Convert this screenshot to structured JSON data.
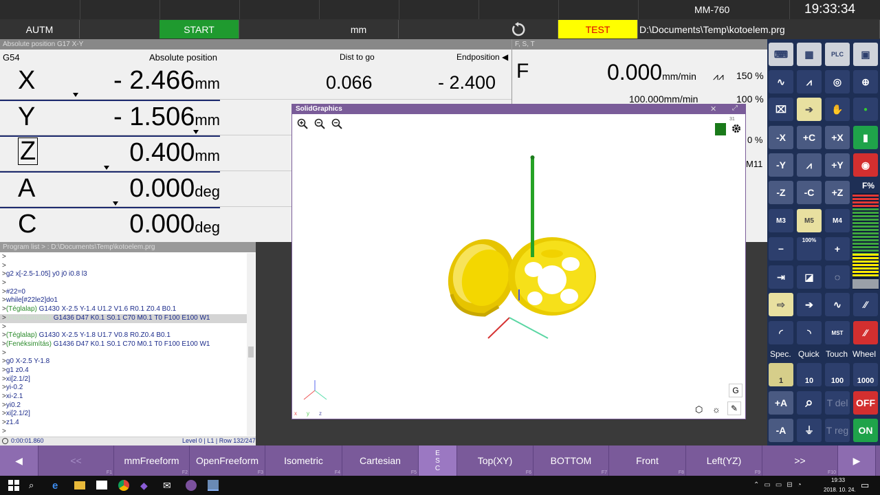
{
  "topbar": {
    "machine": "MM-760",
    "clock": "19:33:34"
  },
  "modebar": {
    "mode": "AUTM",
    "start": "START",
    "unit": "mm",
    "test": "TEST",
    "file": "D:\\Documents\\Temp\\kotoelem.prg"
  },
  "position_panel": {
    "title": "Absolute position G17 X-Y",
    "wcs": "G54",
    "col_abs": "Absolute position",
    "col_dist": "Dist to go",
    "col_end": "Endposition ◀",
    "axes": [
      {
        "name": "X",
        "value": "- 2.466",
        "unit": "mm",
        "dist": "0.066",
        "end": "- 2.400"
      },
      {
        "name": "Y",
        "value": "- 1.506",
        "unit": "mm"
      },
      {
        "name": "Z",
        "value": "0.400",
        "unit": "mm"
      },
      {
        "name": "A",
        "value": "0.000",
        "unit": "deg"
      },
      {
        "name": "C",
        "value": "0.000",
        "unit": "deg"
      }
    ]
  },
  "feed_panel": {
    "title": "F, S, T",
    "f_label": "F",
    "f_value": "0.000",
    "f_unit": "mm/min",
    "f_override": "150 %",
    "f_prog": "100.000mm/min",
    "f_prog_override": "100 %",
    "partial_pct": "0 %",
    "partial_m": "M11"
  },
  "program": {
    "title": "Program list > : D:\\Documents\\Temp\\kotoelem.prg",
    "lines": [
      {
        "p": ">",
        "c": "",
        "t": ""
      },
      {
        "p": ">",
        "c": "",
        "t": ""
      },
      {
        "p": ">",
        "c": "",
        "t": "g2 x[-2.5-1.05] y0 j0 i0.8 l3"
      },
      {
        "p": ">",
        "c": "",
        "t": ""
      },
      {
        "p": ">",
        "c": "",
        "t": "#22=0"
      },
      {
        "p": ">",
        "c": "",
        "t": "while[#22le2]do1"
      },
      {
        "p": ">",
        "c": "(Téglalap)",
        "t": " G1430 X-2.5 Y-1.4 U1.2 V1.6 R0.1 Z0.4 B0.1"
      },
      {
        "p": ">",
        "c": "(Fenéksimítás)",
        "t": " G1436 D47 K0.1 S0.1 C70 M0.1 T0 F100 E100 W1",
        "hl": true
      },
      {
        "p": ">",
        "c": "",
        "t": ""
      },
      {
        "p": ">",
        "c": "(Téglalap)",
        "t": " G1430 X-2.5 Y-1.8 U1.7 V0.8 R0.Z0.4 B0.1"
      },
      {
        "p": ">",
        "c": "(Fenéksimítás)",
        "t": " G1436 D47 K0.1 S0.1 C70 M0.1 T0 F100 E100 W1"
      },
      {
        "p": ">",
        "c": "",
        "t": ""
      },
      {
        "p": ">",
        "c": "",
        "t": "g0 X-2.5 Y-1.8"
      },
      {
        "p": ">",
        "c": "",
        "t": "g1 z0.4"
      },
      {
        "p": ">",
        "c": "",
        "t": "xi[2.1/2]"
      },
      {
        "p": ">",
        "c": "",
        "t": "yi-0.2"
      },
      {
        "p": ">",
        "c": "",
        "t": "xi-2.1"
      },
      {
        "p": ">",
        "c": "",
        "t": "yi0.2"
      },
      {
        "p": ">",
        "c": "",
        "t": "xi[2.1/2]"
      },
      {
        "p": ">",
        "c": "",
        "t": "z1.4"
      },
      {
        "p": ">",
        "c": "",
        "t": ""
      }
    ],
    "time": "0:00:01.860",
    "status": "Level 0 | L1 | Row 132/247"
  },
  "solidgraphics": {
    "title": "SolidGraphics",
    "g_button": "G",
    "badge": "31"
  },
  "toolbar": {
    "jog": [
      "-X",
      "+C",
      "+X",
      "-Y",
      "+Y",
      "-Z",
      "-C",
      "+Z"
    ],
    "spindle": [
      "M3",
      "M5",
      "M4"
    ],
    "spindle_pct": "100%",
    "f_pct": "F%",
    "labels": [
      "Spec.",
      "Quick",
      "Touch",
      "Wheel"
    ],
    "steps": [
      "1",
      "10",
      "100",
      "1000"
    ],
    "plus_a": "+A",
    "minus_a": "-A",
    "t_del": "T del",
    "t_reg": "T reg",
    "off": "OFF",
    "on": "ON"
  },
  "softkeys": [
    {
      "label": "◀",
      "f": ""
    },
    {
      "label": "<<",
      "f": "F1"
    },
    {
      "label": "mmFreeform",
      "f": "F2"
    },
    {
      "label": "OpenFreeform",
      "f": "F3"
    },
    {
      "label": "Isometric",
      "f": "F4"
    },
    {
      "label": "Cartesian",
      "f": "F5"
    },
    {
      "label": "ESC",
      "f": ""
    },
    {
      "label": "Top(XY)",
      "f": "F6"
    },
    {
      "label": "BOTTOM",
      "f": "F7"
    },
    {
      "label": "Front",
      "f": "F8"
    },
    {
      "label": "Left(YZ)",
      "f": "F9"
    },
    {
      "label": ">>",
      "f": "F10"
    },
    {
      "label": "▶",
      "f": ""
    }
  ],
  "taskbar": {
    "time": "19:33",
    "date": "2018. 10. 24."
  }
}
